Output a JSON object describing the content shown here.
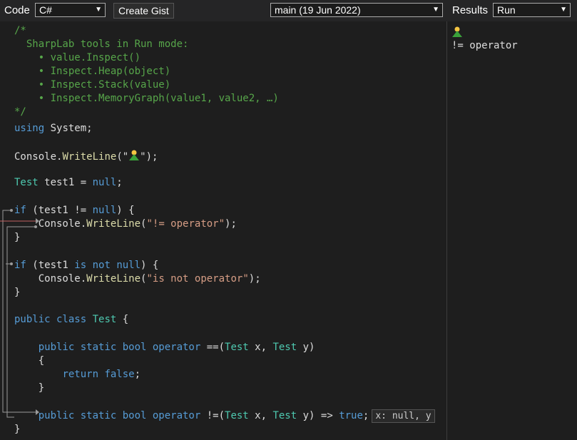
{
  "toolbar": {
    "code_label": "Code",
    "language": "C#",
    "create_gist": "Create Gist",
    "branch": "main (19 Jun 2022)",
    "results_label": "Results",
    "mode": "Run"
  },
  "code": {
    "comment": [
      "/*",
      "  SharpLab tools in Run mode:",
      "    • value.Inspect()",
      "    • Inspect.Heap(object)",
      "    • Inspect.Stack(value)",
      "    • Inspect.MemoryGraph(value1, value2, …)",
      "*/"
    ],
    "using": [
      "using",
      " System;"
    ],
    "writeline_person": [
      "Console",
      ".",
      "WriteLine",
      "(\"",
      "\");"
    ],
    "test_decl": [
      "Test",
      " test1 = ",
      "null",
      ";"
    ],
    "if1": [
      "if",
      " (test1 != ",
      "null",
      ") {"
    ],
    "body1": [
      "    ",
      "Console",
      ".",
      "WriteLine",
      "(",
      "\"!= operator\"",
      ");"
    ],
    "brace_close": "}",
    "if2": [
      "if",
      " (test1 ",
      "is not",
      " ",
      "null",
      ") {"
    ],
    "body2": [
      "    ",
      "Console",
      ".",
      "WriteLine",
      "(",
      "\"is not operator\"",
      ");"
    ],
    "class_decl": [
      "public class",
      " ",
      "Test",
      " {"
    ],
    "op_eq": [
      "    ",
      "public static bool operator",
      " ==(",
      "Test",
      " x, ",
      "Test",
      " y)"
    ],
    "brace_open_indent": "    {",
    "return_false": [
      "        ",
      "return false",
      ";"
    ],
    "brace_close_indent": "    }",
    "op_neq": [
      "    ",
      "public static bool operator",
      " !=(",
      "Test",
      " x, ",
      "Test",
      " y) => ",
      "true",
      ";"
    ],
    "hint": "x: null, y"
  },
  "results": {
    "output": "!= operator"
  }
}
